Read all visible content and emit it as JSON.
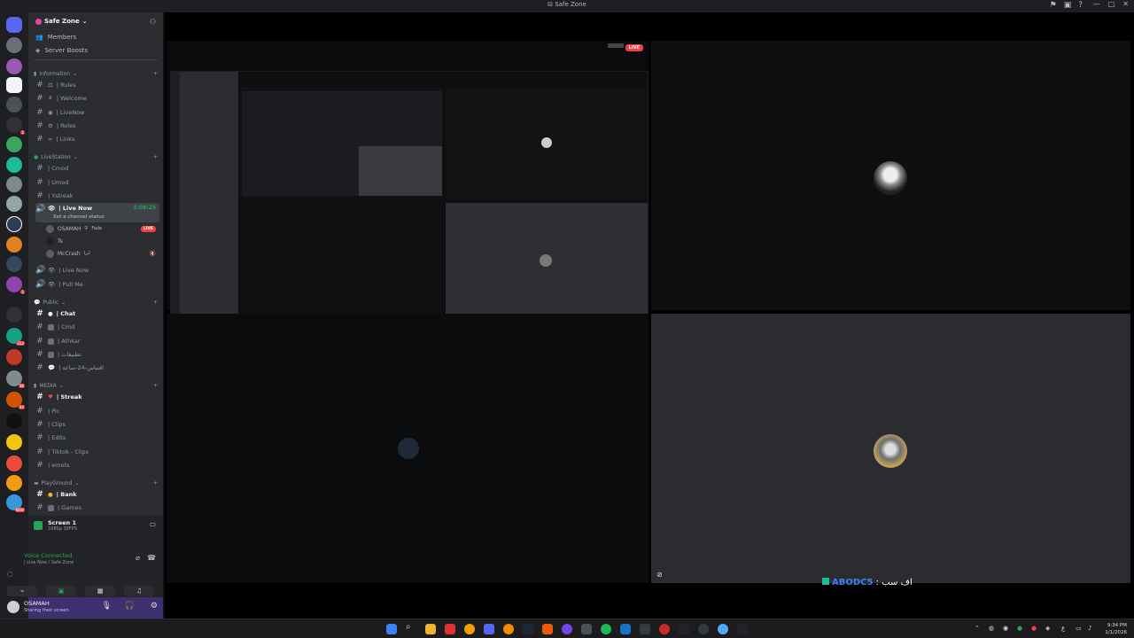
{
  "window": {
    "title": "Safe Zone",
    "icons": [
      "inbox-icon",
      "screen-icon",
      "help-icon"
    ]
  },
  "server": {
    "name": "Safe Zone",
    "links": [
      {
        "label": "Members",
        "icon": "members-icon"
      },
      {
        "label": "Server Boosts",
        "icon": "boost-icon"
      }
    ]
  },
  "categories": {
    "information": "Information",
    "livestation": "LiveStation",
    "public": "Public",
    "media": "MEDIA",
    "playground": "PlayGround"
  },
  "channels": {
    "rules": "| Rules",
    "welcome": "| Welcome",
    "livenow_text": "| LiveNow",
    "roles": "| Roles",
    "links": "| Links",
    "cmod": "| Cmod",
    "umod": "| Umod",
    "ystreak": "| Ystreak",
    "live_now_voice": "| Live Now",
    "live_now_voice_status": "Set a channel status",
    "live_now_timer": "2:08:25",
    "live_now_2": "| Live Now",
    "pull_me": "| Pull Me",
    "chat": "| Chat",
    "cmd": "| Cmd",
    "athkar": "| Athkar",
    "arabic1": "| تطبيقات",
    "arabic2": "| اقتباس-24-ساعه",
    "streak": "| Streak",
    "pic": "| Pic",
    "clips": "| Clips",
    "edits": "| Edits",
    "tiktok": "| Tiktok - Clips",
    "emots": "| emots",
    "bank": "| Bank",
    "games": "| Games"
  },
  "voice_users": [
    {
      "name": "OSAMAH",
      "tag": "Fade",
      "live": "LIVE"
    },
    {
      "name": "Ts",
      "tag": "",
      "live": ""
    },
    {
      "name": "McCrash",
      "tag": "ايرا",
      "live": ""
    }
  ],
  "screen_panel": {
    "title": "Screen 1",
    "subtitle": "1080p 30FPS"
  },
  "voice_panel": {
    "status": "Voice Connected",
    "location": "| Live Now / Safe Zone"
  },
  "user_panel": {
    "name": "OSAMAH",
    "status": "Sharing their screen"
  },
  "stream": {
    "live_badge": "LIVE",
    "caption_name": "ABODC5",
    "caption_suffix": ": اف سب"
  },
  "taskbar": {
    "time": "9:34 PM",
    "date": "1/1/2026",
    "lang": "ع"
  },
  "colors": {
    "accent": "#5865f2",
    "live": "#f23f43",
    "online": "#23a55a",
    "sidebar": "#2b2d31"
  }
}
